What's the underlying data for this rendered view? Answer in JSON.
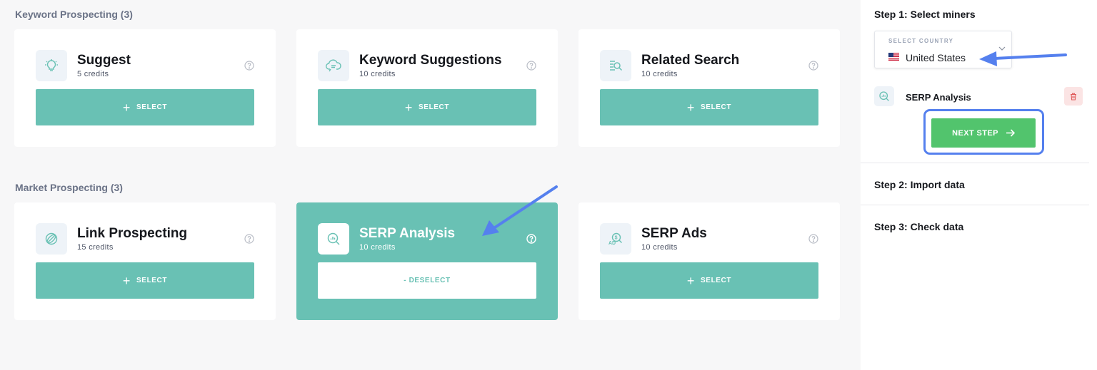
{
  "sections": {
    "keyword": "Keyword Prospecting (3)",
    "market": "Market Prospecting (3)"
  },
  "cards": [
    {
      "title": "Suggest",
      "credits": "5 credits",
      "button": "SELECT",
      "icon": "lightbulb-icon"
    },
    {
      "title": "Keyword Suggestions",
      "credits": "10 credits",
      "button": "SELECT",
      "icon": "cloud-chat-icon"
    },
    {
      "title": "Related Search",
      "credits": "10 credits",
      "button": "SELECT",
      "icon": "search-list-icon"
    },
    {
      "title": "Link Prospecting",
      "credits": "15 credits",
      "button": "SELECT",
      "icon": "link-globe-icon"
    },
    {
      "title": "SERP Analysis",
      "credits": "10 credits",
      "button": "- DESELECT",
      "icon": "serp-chart-search-icon",
      "selected": true
    },
    {
      "title": "SERP Ads",
      "credits": "10 credits",
      "button": "SELECT",
      "icon": "ad-search-icon"
    }
  ],
  "sidebar": {
    "step1": "Step 1: Select miners",
    "country_label": "SELECT COUNTRY",
    "country_value": "United States",
    "selected_miner": "SERP Analysis",
    "next_button": "NEXT STEP",
    "step2": "Step 2: Import data",
    "step3": "Step 3: Check data"
  },
  "colors": {
    "teal": "#69c1b4",
    "green": "#52c46d",
    "annotation_blue": "#5580ee"
  }
}
